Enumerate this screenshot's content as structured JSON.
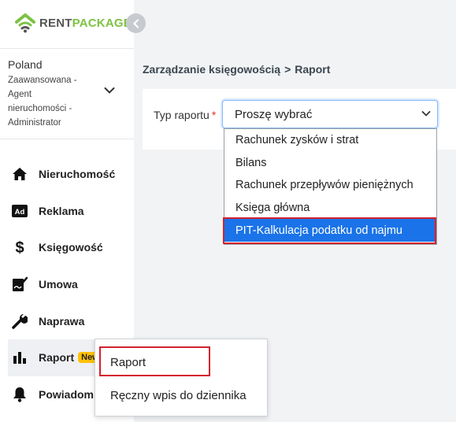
{
  "logo": {
    "part1": "RENT",
    "part2": "PACKAGE"
  },
  "account": {
    "country": "Poland",
    "role_lines": [
      "Zaawansowana -",
      "Agent",
      "nieruchomości -",
      "Administrator"
    ]
  },
  "nav": [
    {
      "label": "Nieruchomość",
      "icon": "home-icon"
    },
    {
      "label": "Reklama",
      "icon": "ad-icon"
    },
    {
      "label": "Księgowość",
      "icon": "dollar-icon"
    },
    {
      "label": "Umowa",
      "icon": "contract-sign-icon"
    },
    {
      "label": "Naprawa",
      "icon": "wrench-icon"
    },
    {
      "label": "Raport",
      "icon": "bar-chart-icon",
      "badge": "New"
    },
    {
      "label": "Powiadomi",
      "icon": "bell-icon"
    }
  ],
  "breadcrumb": {
    "parent": "Zarządzanie księgowością",
    "separator": ">",
    "current": "Raport"
  },
  "form": {
    "label": "Typ raportu",
    "required_mark": "*",
    "select_value": "Proszę wybrać",
    "options": [
      "Rachunek zysków i strat",
      "Bilans",
      "Rachunek przepływów pieniężnych",
      "Księga główna",
      "PIT-Kalkulacja podatku od najmu"
    ],
    "selected_index": 4
  },
  "submenu": [
    "Raport",
    "Ręczny wpis do dziennika"
  ],
  "colors": {
    "brand_green": "#7cc242",
    "select_highlight": "#1a73e8",
    "annotation_red": "#d3222e",
    "badge_yellow": "#ffc107"
  }
}
